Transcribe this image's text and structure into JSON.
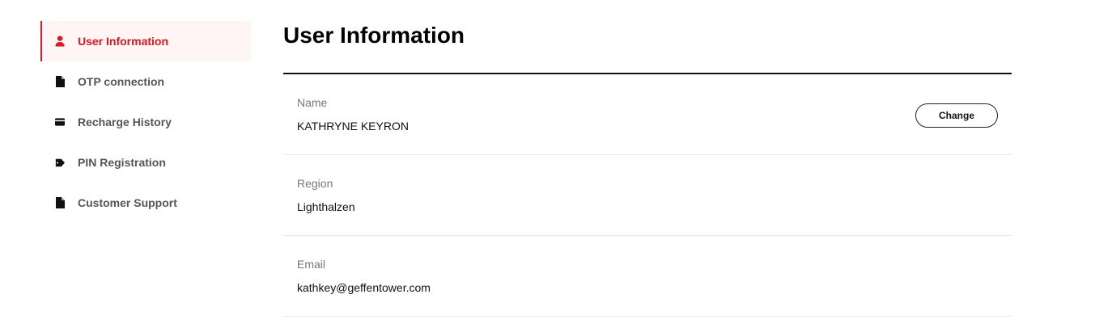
{
  "sidebar": {
    "items": [
      {
        "label": "User Information",
        "icon": "user-icon",
        "active": true
      },
      {
        "label": "OTP connection",
        "icon": "document-icon",
        "active": false
      },
      {
        "label": "Recharge History",
        "icon": "card-icon",
        "active": false
      },
      {
        "label": "PIN Registration",
        "icon": "tag-icon",
        "active": false
      },
      {
        "label": "Customer Support",
        "icon": "document-icon",
        "active": false
      }
    ]
  },
  "main": {
    "title": "User Information",
    "fields": [
      {
        "label": "Name",
        "value": "KATHRYNE KEYRON"
      },
      {
        "label": "Region",
        "value": "Lighthalzen"
      },
      {
        "label": "Email",
        "value": "kathkey@geffentower.com"
      }
    ],
    "change_label": "Change"
  },
  "colors": {
    "accent": "#d71920",
    "active_bg": "#fff5f5",
    "muted_text": "#555555",
    "label_text": "#777777"
  }
}
